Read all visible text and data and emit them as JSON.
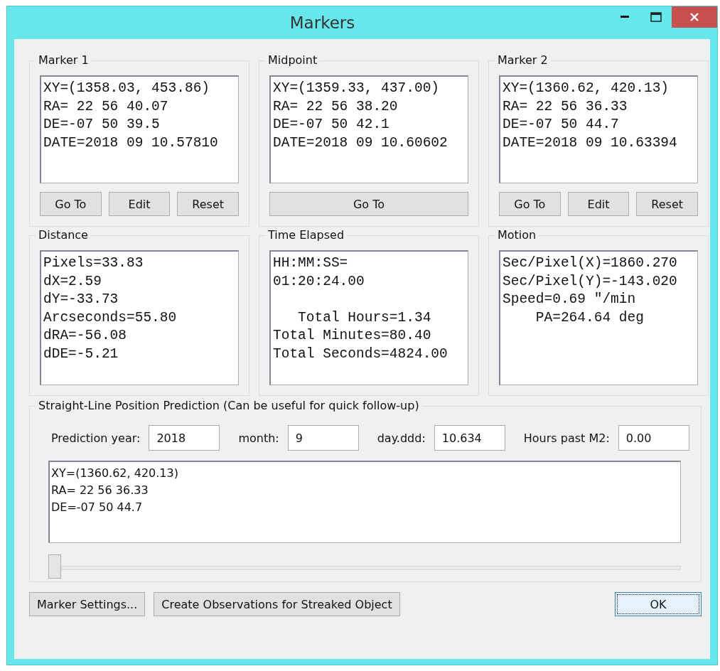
{
  "window": {
    "title": "Markers",
    "controls": [
      {
        "kind": "minimize"
      },
      {
        "kind": "maximize"
      },
      {
        "kind": "close"
      }
    ]
  },
  "groups": [
    {
      "title": "Marker 1",
      "text": "XY=(1358.03, 453.86)\nRA= 22 56 40.07\nDE=-07 50 39.5\nDATE=2018 09 10.57810",
      "buttons": [
        "Go To",
        "Edit",
        "Reset"
      ]
    },
    {
      "title": "Midpoint",
      "text": "XY=(1359.33, 437.00)\nRA= 22 56 38.20\nDE=-07 50 42.1\nDATE=2018 09 10.60602",
      "buttons": [
        "Go To"
      ]
    },
    {
      "title": "Marker 2",
      "text": "XY=(1360.62, 420.13)\nRA= 22 56 36.33\nDE=-07 50 44.7\nDATE=2018 09 10.63394",
      "buttons": [
        "Go To",
        "Edit",
        "Reset"
      ]
    },
    {
      "title": "Distance",
      "text": "Pixels=33.83\ndX=2.59\ndY=-33.73\nArcseconds=55.80\ndRA=-56.08\ndDE=-5.21"
    },
    {
      "title": "Time Elapsed",
      "text": "HH:MM:SS=\n01:20:24.00\n\n   Total Hours=1.34\nTotal Minutes=80.40\nTotal Seconds=4824.00"
    },
    {
      "title": "Motion",
      "text": "Sec/Pixel(X)=1860.270\nSec/Pixel(Y)=-143.020\nSpeed=0.69 \"/min\n    PA=264.64 deg"
    }
  ],
  "prediction": {
    "title": "Straight-Line Position Prediction (Can be useful for quick follow-up)",
    "fields": [
      {
        "label": "Prediction year:",
        "value": "2018"
      },
      {
        "label": "month:",
        "value": "9"
      },
      {
        "label": "day.ddd:",
        "value": "10.634"
      },
      {
        "label": "Hours past M2:",
        "value": "0.00"
      }
    ],
    "result": "XY=(1360.62, 420.13)\nRA= 22 56 36.33\nDE=-07 50 44.7",
    "slider": {
      "level": 0
    }
  },
  "buttons": [
    {
      "label": "Marker Settings...",
      "focused": false
    },
    {
      "label": "Create Observations for Streaked Object",
      "focused": false
    },
    {
      "label": "OK",
      "focused": true
    }
  ]
}
